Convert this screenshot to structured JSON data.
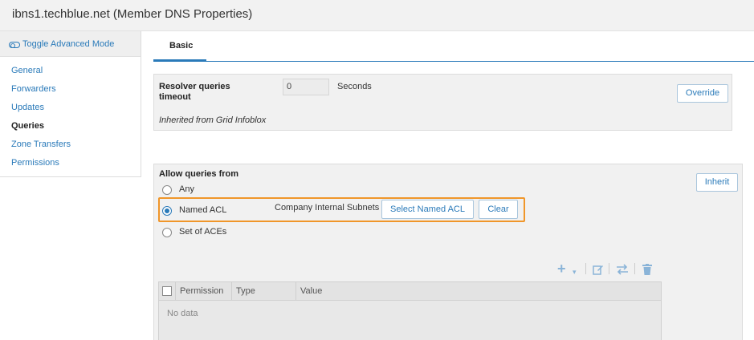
{
  "window": {
    "title": "ibns1.techblue.net (Member DNS Properties)"
  },
  "sidebar": {
    "toggle_label": "Toggle Advanced Mode",
    "items": [
      {
        "label": "General",
        "active": false
      },
      {
        "label": "Forwarders",
        "active": false
      },
      {
        "label": "Updates",
        "active": false
      },
      {
        "label": "Queries",
        "active": true
      },
      {
        "label": "Zone Transfers",
        "active": false
      },
      {
        "label": "Permissions",
        "active": false
      }
    ]
  },
  "tabs": [
    {
      "label": "Basic",
      "active": true
    }
  ],
  "resolver": {
    "label_line1": "Resolver queries",
    "label_line2": "timeout",
    "value": "0",
    "unit": "Seconds",
    "override_label": "Override",
    "inherited_note": "Inherited from Grid Infoblox"
  },
  "allow_queries": {
    "heading": "Allow queries from",
    "inherit_label": "Inherit",
    "options": [
      {
        "label": "Any",
        "selected": false
      },
      {
        "label": "Named ACL",
        "selected": true
      },
      {
        "label": "Set of ACEs",
        "selected": false
      }
    ],
    "named_acl_value": "Company Internal Subnets",
    "select_named_acl_label": "Select Named ACL",
    "clear_label": "Clear"
  },
  "toolbar_icons": [
    "add-icon",
    "chevron-down-icon",
    "edit-icon",
    "reorder-icon",
    "delete-icon"
  ],
  "table": {
    "columns": [
      "Permission",
      "Type",
      "Value"
    ],
    "empty_text": "No data"
  },
  "colors": {
    "accent": "#2a7ab9",
    "highlight": "#f0962a",
    "panel_bg": "#f1f1f1"
  }
}
